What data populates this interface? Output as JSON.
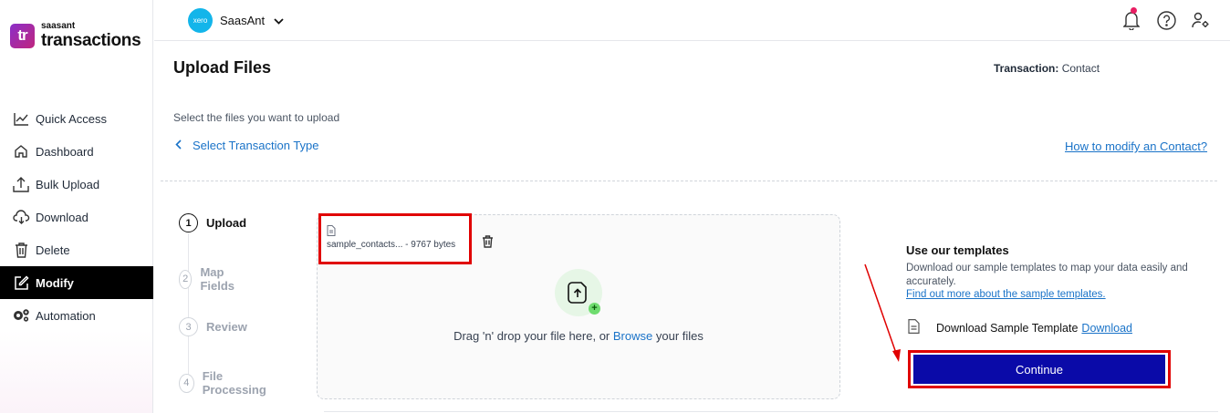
{
  "app": {
    "logo_small": "saasant",
    "logo_big": "transactions",
    "logo_mark": "tr"
  },
  "sidebar": {
    "items": [
      {
        "label": "Quick Access",
        "icon": "chart-line-icon"
      },
      {
        "label": "Dashboard",
        "icon": "home-icon"
      },
      {
        "label": "Bulk Upload",
        "icon": "upload-icon"
      },
      {
        "label": "Download",
        "icon": "cloud-download-icon"
      },
      {
        "label": "Delete",
        "icon": "trash-icon"
      },
      {
        "label": "Modify",
        "icon": "edit-icon",
        "active": true
      },
      {
        "label": "Automation",
        "icon": "gears-icon"
      }
    ]
  },
  "topbar": {
    "org_badge": "xero",
    "org_name": "SaasAnt"
  },
  "header": {
    "title": "Upload Files",
    "transaction_label": "Transaction:",
    "transaction_value": "Contact",
    "subtitle": "Select the files you want to upload",
    "back_label": "Select Transaction Type",
    "help_link": "How to modify an Contact?"
  },
  "steps": [
    {
      "num": "1",
      "label": "Upload",
      "active": true
    },
    {
      "num": "2",
      "label": "Map Fields"
    },
    {
      "num": "3",
      "label": "Review"
    },
    {
      "num": "4",
      "label": "File Processing"
    }
  ],
  "upload": {
    "file_name": "sample_contacts... - 9767 bytes",
    "drop_prefix": "Drag 'n' drop your file here, or",
    "browse": "Browse",
    "drop_suffix": "your files"
  },
  "templates": {
    "title": "Use our templates",
    "desc": "Download our sample templates to map your data easily and accurately.",
    "more_link": "Find out more about the sample templates.",
    "download_text": "Download Sample Template",
    "download_link": "Download",
    "continue": "Continue"
  },
  "colors": {
    "accent": "#1a73c8",
    "primary_button": "#0a0aa8",
    "highlight": "#e00000",
    "active_nav": "#000000"
  }
}
